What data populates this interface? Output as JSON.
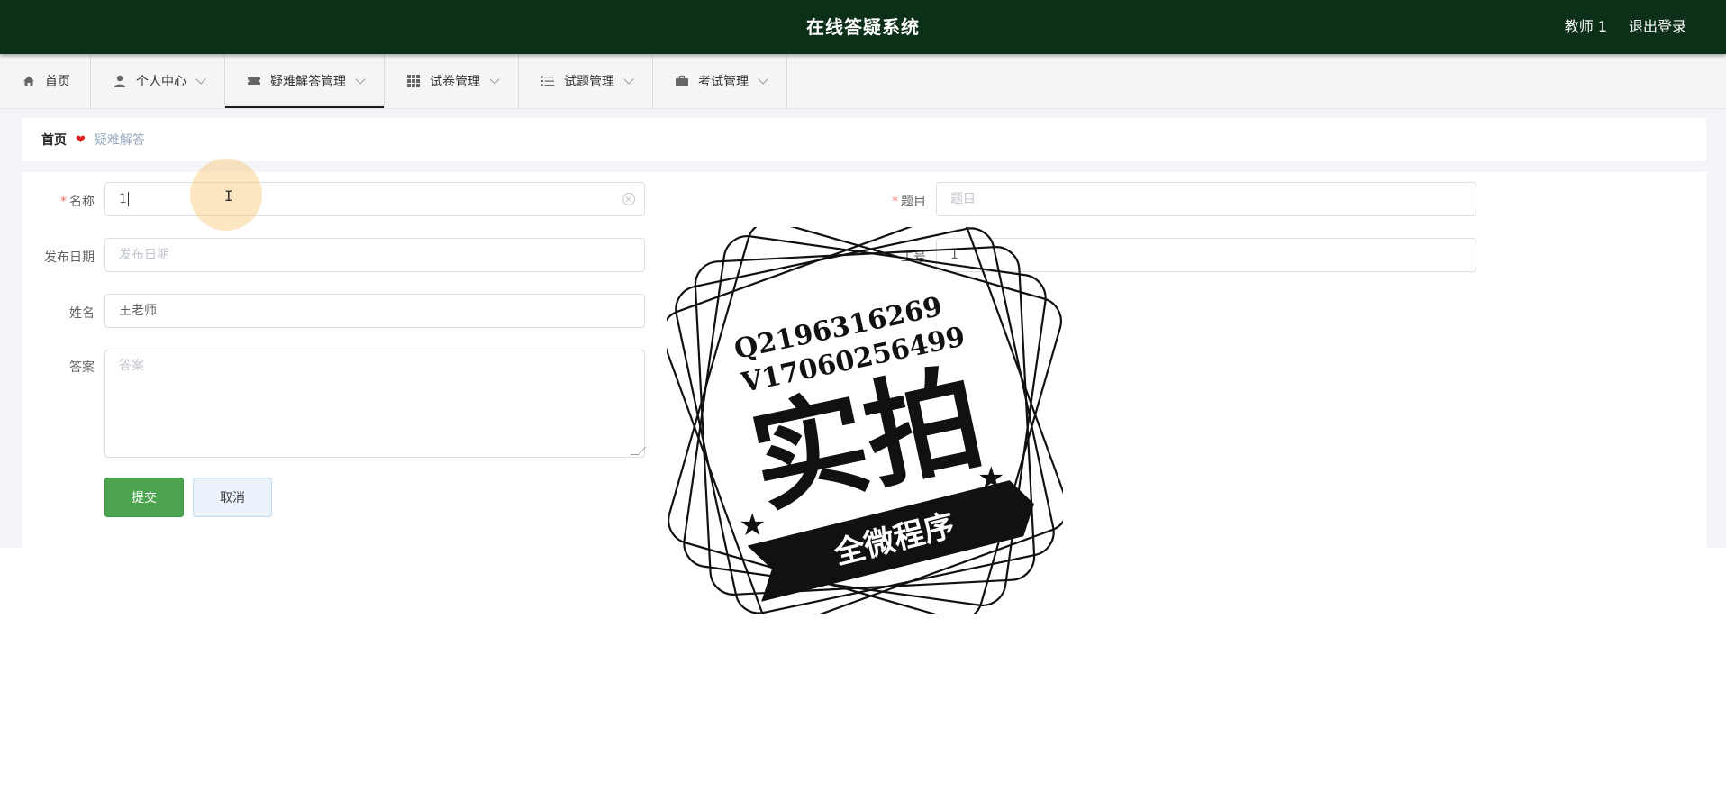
{
  "app_title": "在线答疑系统",
  "header": {
    "user": "教师 1",
    "logout": "退出登录"
  },
  "menu": [
    {
      "label": "首页",
      "icon": "home-icon",
      "dropdown": false
    },
    {
      "label": "个人中心",
      "icon": "user-icon",
      "dropdown": true
    },
    {
      "label": "疑难解答管理",
      "icon": "ticket-icon",
      "dropdown": true,
      "active": true
    },
    {
      "label": "试卷管理",
      "icon": "grid-icon",
      "dropdown": true
    },
    {
      "label": "试题管理",
      "icon": "list-icon",
      "dropdown": true
    },
    {
      "label": "考试管理",
      "icon": "briefcase-icon",
      "dropdown": true
    }
  ],
  "breadcrumb": {
    "home": "首页",
    "current": "疑难解答"
  },
  "form": {
    "name": {
      "label": "名称",
      "value": "1",
      "required": true
    },
    "topic": {
      "label": "题目",
      "placeholder": "题目",
      "required": true
    },
    "publish_date": {
      "label": "发布日期",
      "placeholder": "发布日期"
    },
    "job_number": {
      "label": "工号",
      "value": "1"
    },
    "teacher_name": {
      "label": "姓名",
      "value": "王老师"
    },
    "answer": {
      "label": "答案",
      "placeholder": "答案"
    },
    "submit": "提交",
    "cancel": "取消"
  },
  "watermark": {
    "line1": "Q2196316269",
    "line2": "V17060256499",
    "big": "实拍",
    "banner": "全微程序"
  },
  "colors": {
    "header_bg": "#0c2f18",
    "submit_bg": "#4ca54e",
    "required": "#f56c6c",
    "breadcrumb_sep": "#e0201e"
  }
}
